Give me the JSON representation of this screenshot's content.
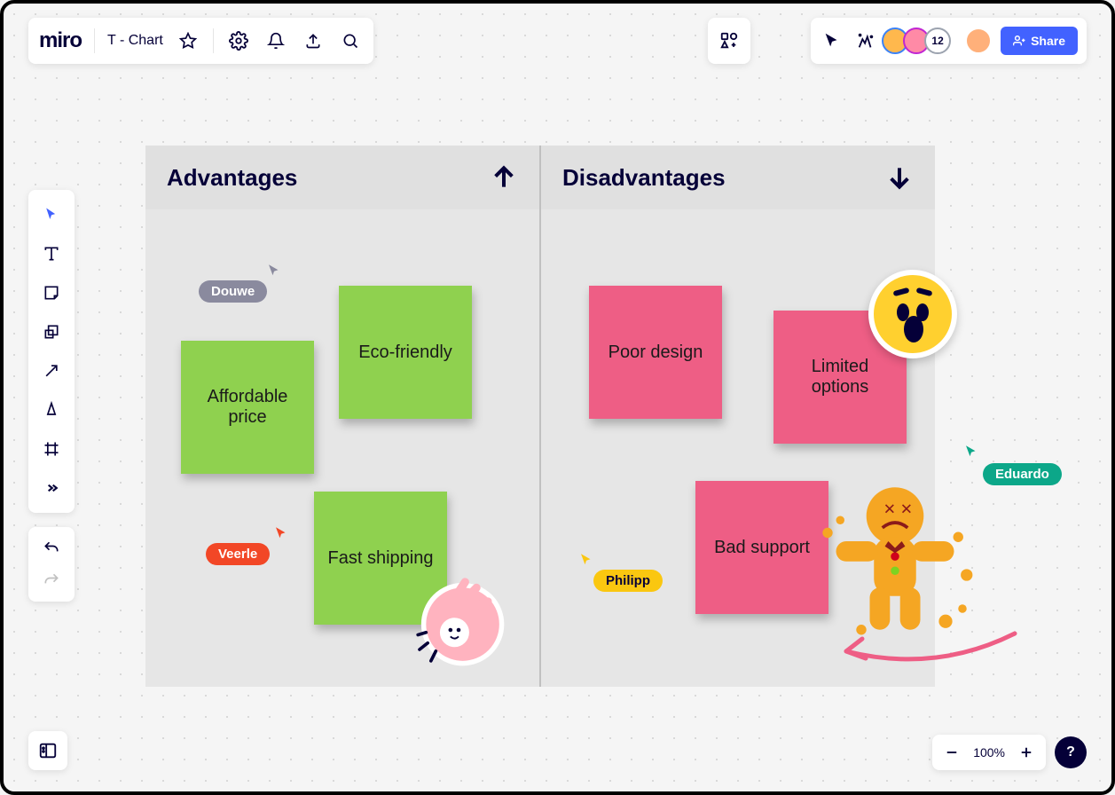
{
  "app": {
    "logo": "miro",
    "board_title": "T - Chart"
  },
  "topbar": {
    "participant_count": "12",
    "share_label": "Share"
  },
  "zoom": {
    "level": "100%"
  },
  "tchart": {
    "left_header": "Advantages",
    "right_header": "Disadvantages"
  },
  "stickies": {
    "affordable": "Affordable price",
    "eco": "Eco-friendly",
    "fast": "Fast shipping",
    "poor": "Poor design",
    "limited": "Limited options",
    "bad": "Bad support"
  },
  "cursors": {
    "douwe": "Douwe",
    "veerle": "Veerle",
    "philipp": "Philipp",
    "eduardo": "Eduardo"
  },
  "help": {
    "label": "?"
  }
}
